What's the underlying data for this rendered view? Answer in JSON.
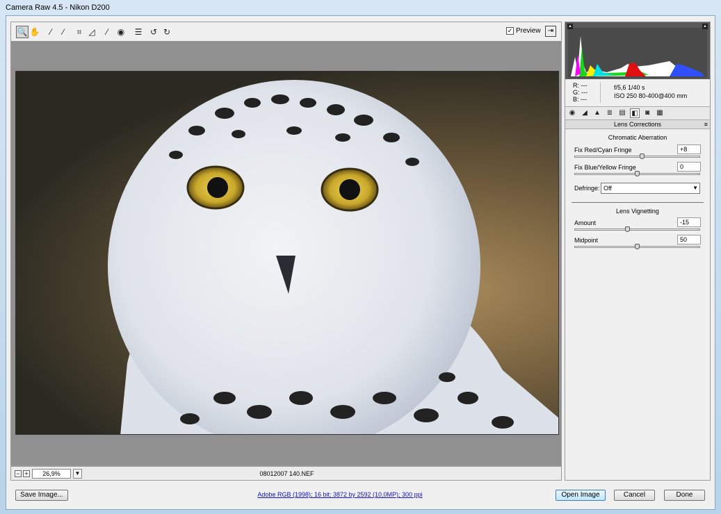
{
  "window": {
    "title": "Camera Raw 4.5  -  Nikon D200"
  },
  "toolbar": {
    "tools": [
      {
        "name": "zoom-tool-icon",
        "glyph": "🔍"
      },
      {
        "name": "hand-tool-icon",
        "glyph": "✋"
      },
      {
        "name": "white-balance-tool-icon",
        "glyph": "⁄"
      },
      {
        "name": "color-sampler-tool-icon",
        "glyph": "⁄"
      },
      {
        "name": "crop-tool-icon",
        "glyph": "⌗"
      },
      {
        "name": "straighten-tool-icon",
        "glyph": "◿"
      },
      {
        "name": "retouch-tool-icon",
        "glyph": "⁄"
      },
      {
        "name": "red-eye-tool-icon",
        "glyph": "◉"
      },
      {
        "name": "preferences-icon",
        "glyph": "☰"
      },
      {
        "name": "rotate-left-icon",
        "glyph": "↺"
      },
      {
        "name": "rotate-right-icon",
        "glyph": "↻"
      }
    ],
    "preview_label": "Preview",
    "preview_checked": "✓",
    "fullscreen_glyph": "⇥"
  },
  "statusbar": {
    "zoom_out": "−",
    "zoom_in": "+",
    "zoom": "26,9%",
    "zoom_arrow": "▼",
    "filename": "08012007 140.NEF"
  },
  "readout": {
    "r": "R:   ---",
    "g": "G:   ---",
    "b": "B:   ---",
    "aperture_shutter": "f/5,6    1/40 s",
    "iso_lens": "ISO 250    80-400@400 mm"
  },
  "panel": {
    "title": "Lens Corrections",
    "menu_glyph": "≡",
    "chromatic_title": "Chromatic Aberration",
    "fix_red_cyan_label": "Fix Red/Cyan Fringe",
    "fix_red_cyan_value": "+8",
    "fix_red_cyan_level": 0.54,
    "fix_blue_yellow_label": "Fix Blue/Yellow Fringe",
    "fix_blue_yellow_value": "0",
    "fix_blue_yellow_level": 0.5,
    "defringe_label": "Defringe:",
    "defringe_value": "Off",
    "defringe_arrow": "▼",
    "vignetting_title": "Lens Vignetting",
    "amount_label": "Amount",
    "amount_value": "-15",
    "amount_level": 0.425,
    "midpoint_label": "Midpoint",
    "midpoint_value": "50",
    "midpoint_level": 0.5
  },
  "tabs": [
    {
      "name": "tab-basic-icon",
      "glyph": "◉"
    },
    {
      "name": "tab-tone-curve-icon",
      "glyph": "◢"
    },
    {
      "name": "tab-detail-icon",
      "glyph": "▲"
    },
    {
      "name": "tab-hsl-icon",
      "glyph": "≣"
    },
    {
      "name": "tab-split-toning-icon",
      "glyph": "▤"
    },
    {
      "name": "tab-lens-corrections-icon",
      "glyph": "◧"
    },
    {
      "name": "tab-camera-calibration-icon",
      "glyph": "◙"
    },
    {
      "name": "tab-presets-icon",
      "glyph": "▦"
    }
  ],
  "buttons": {
    "save_image": "Save Image...",
    "workflow_info": "Adobe RGB (1998); 16 bit; 3872 by 2592 (10,0MP); 300 ppi",
    "open_image": "Open Image",
    "cancel": "Cancel",
    "done": "Done"
  },
  "histogram_warning_glyph": "▲",
  "colors": {
    "accent": "#3c7fb1",
    "link": "#1010c0"
  }
}
